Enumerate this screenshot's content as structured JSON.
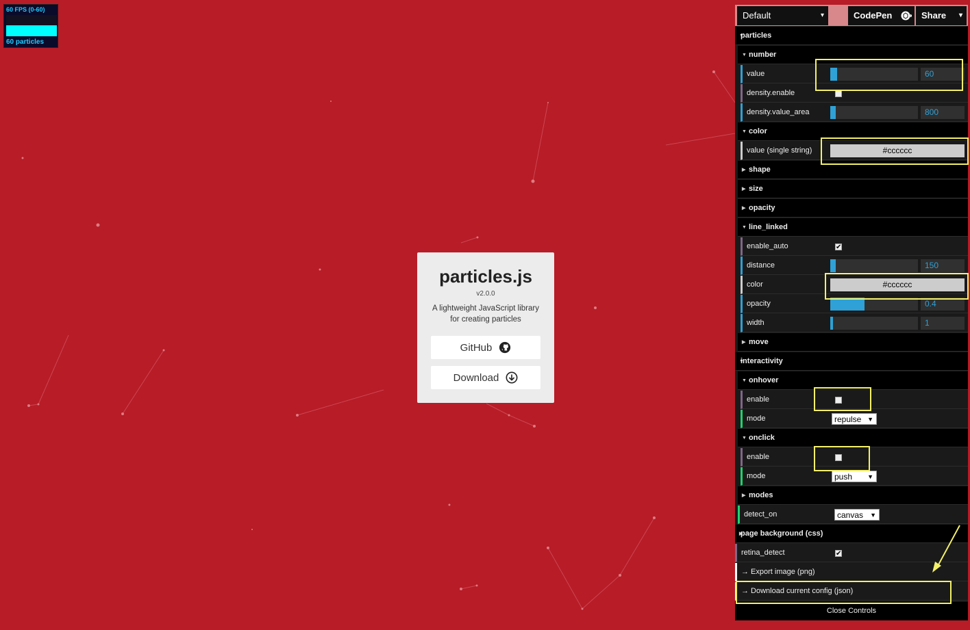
{
  "fps_meter": {
    "title": "60 FPS (0-60)",
    "count": "60 particles"
  },
  "card": {
    "title": "particles.js",
    "version": "v2.0.0",
    "description": "A lightweight JavaScript library for creating particles",
    "github_label": "GitHub",
    "download_label": "Download"
  },
  "topbar": {
    "preset": "Default",
    "codepen": "CodePen",
    "share": "Share"
  },
  "panel": {
    "particles": "particles",
    "number": "number",
    "number_value_label": "value",
    "number_value": "60",
    "density_enable_label": "density.enable",
    "density_enable": false,
    "density_value_area_label": "density.value_area",
    "density_value_area": "800",
    "color": "color",
    "color_value_label": "value (single string)",
    "color_value": "#cccccc",
    "shape": "shape",
    "size": "size",
    "opacity": "opacity",
    "line_linked": "line_linked",
    "ll_enable_auto_label": "enable_auto",
    "ll_enable_auto": true,
    "ll_distance_label": "distance",
    "ll_distance": "150",
    "ll_color_label": "color",
    "ll_color": "#cccccc",
    "ll_opacity_label": "opacity",
    "ll_opacity": "0.4",
    "ll_width_label": "width",
    "ll_width": "1",
    "move": "move",
    "interactivity": "interactivity",
    "onhover": "onhover",
    "onhover_enable_label": "enable",
    "onhover_enable": false,
    "onhover_mode_label": "mode",
    "onhover_mode": "repulse",
    "onclick": "onclick",
    "onclick_enable_label": "enable",
    "onclick_enable": false,
    "onclick_mode_label": "mode",
    "onclick_mode": "push",
    "modes": "modes",
    "detect_on_label": "detect_on",
    "detect_on": "canvas",
    "page_background": "page background (css)",
    "retina_detect_label": "retina_detect",
    "retina_detect": true,
    "export_image": "→ Export image (png)",
    "download_config": "→ Download current config (json)",
    "close_controls": "Close Controls"
  },
  "colors": {
    "background": "#b71c27",
    "accent": "#2fa1d6",
    "highlight": "#f4f06a"
  }
}
